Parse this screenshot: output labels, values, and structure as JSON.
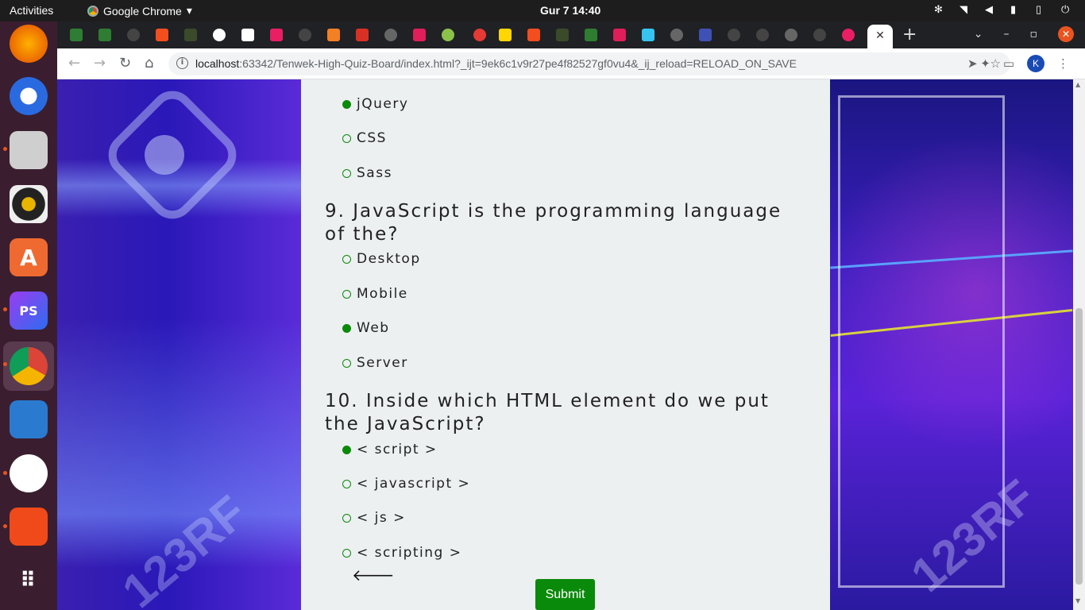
{
  "topbar": {
    "activities": "Activities",
    "app_name": "Google Chrome",
    "clock": "Gur 7  14:40"
  },
  "browser": {
    "url_host": "localhost",
    "url_rest": ":63342/Tenwek-High-Quiz-Board/index.html?_ijt=9ek6c1v9r27pe4f82527gf0vu4&_ij_reload=RELOAD_ON_SAVE",
    "profile_initial": "K"
  },
  "quiz": {
    "prev_options": [
      {
        "label": "jQuery",
        "checked": true
      },
      {
        "label": "CSS",
        "checked": false
      },
      {
        "label": "Sass",
        "checked": false
      }
    ],
    "q9": {
      "text": "9. JavaScript is the programming language of the?",
      "options": [
        {
          "label": "Desktop",
          "checked": false
        },
        {
          "label": "Mobile",
          "checked": false
        },
        {
          "label": "Web",
          "checked": true
        },
        {
          "label": "Server",
          "checked": false
        }
      ]
    },
    "q10": {
      "text": "10. Inside which HTML element do we put the JavaScript?",
      "options": [
        {
          "label": "< script >",
          "checked": true
        },
        {
          "label": "< javascript >",
          "checked": false
        },
        {
          "label": "< js >",
          "checked": false
        },
        {
          "label": "< scripting >",
          "checked": false
        }
      ]
    },
    "submit_label": "Submit"
  },
  "colors": {
    "accent_green": "#0a8a0a",
    "dock_bg": "#3a1e2f",
    "quiz_bg": "#edf0f1"
  }
}
